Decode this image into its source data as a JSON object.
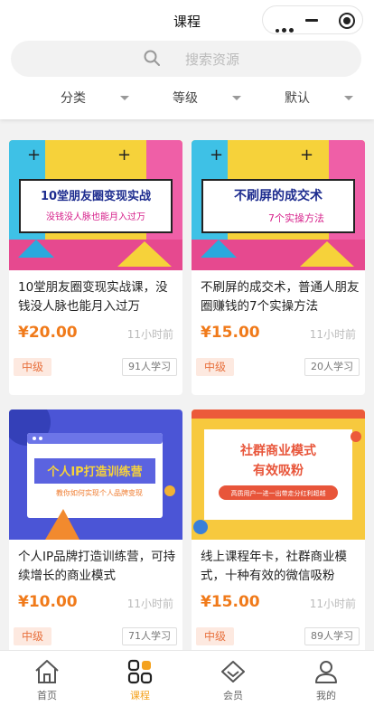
{
  "header": {
    "title": "课程"
  },
  "search": {
    "placeholder": "搜索资源"
  },
  "filters": [
    "分类",
    "等级",
    "默认"
  ],
  "courses": [
    {
      "banner_line1": "10堂朋友圈变现实战",
      "banner_line2": "没钱没人脉也能月入过万",
      "title": "10堂朋友圈变现实战课，没钱没人脉也能月入过万",
      "price": "¥20.00",
      "time": "11小时前",
      "level": "中级",
      "learners": "91人学习"
    },
    {
      "banner_line1": "不刷屏的成交术",
      "banner_line2": "7个实操方法",
      "title": "不刷屏的成交术，普通人朋友圈赚钱的7个实操方法",
      "price": "¥15.00",
      "time": "11小时前",
      "level": "中级",
      "learners": "20人学习"
    },
    {
      "banner_line1": "个人IP打造训练营",
      "banner_line2": "教你如何实现个人品牌变现",
      "title": "个人IP品牌打造训练营，可持续增长的商业模式",
      "price": "¥10.00",
      "time": "11小时前",
      "level": "中级",
      "learners": "71人学习"
    },
    {
      "banner_line1": "社群商业模式",
      "banner_line2": "有效吸粉",
      "banner_line3": "高质用户一进一出带走分红利超越",
      "title": "线上课程年卡，社群商业模式，十种有效的微信吸粉",
      "price": "¥15.00",
      "time": "11小时前",
      "level": "中级",
      "learners": "89人学习"
    }
  ],
  "tabbar": [
    {
      "label": "首页",
      "icon": "home-icon"
    },
    {
      "label": "课程",
      "icon": "course-grid-icon",
      "active": true
    },
    {
      "label": "会员",
      "icon": "diamond-icon"
    },
    {
      "label": "我的",
      "icon": "user-icon"
    }
  ],
  "colors": {
    "accent": "#f4a21e",
    "price": "#f07a1a",
    "level_bg": "#fde9e0",
    "level_text": "#e8713e"
  }
}
